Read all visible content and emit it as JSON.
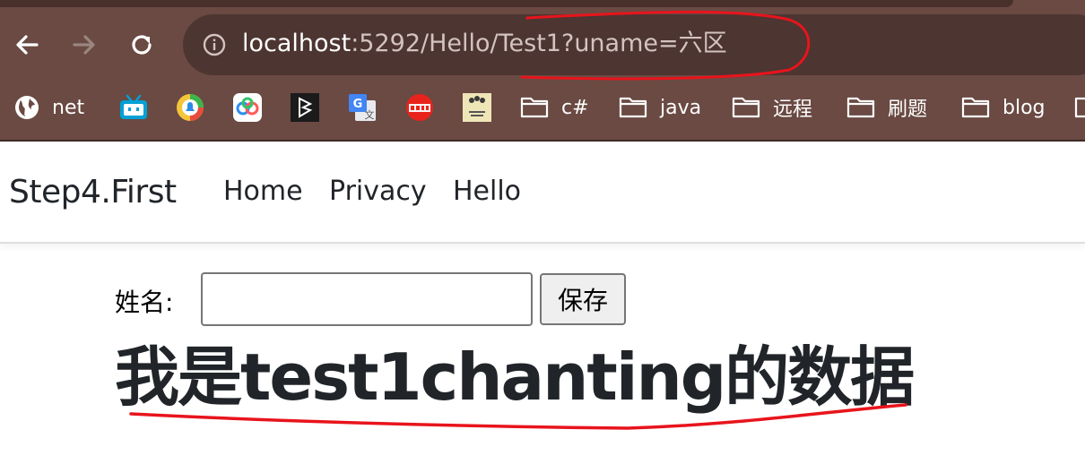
{
  "browser": {
    "url": {
      "host": "localhost",
      "path": ":5292/Hello/Test1?uname=六区"
    },
    "nav": {
      "back_icon": "arrow-left-icon",
      "forward_icon": "arrow-right-icon",
      "reload_icon": "reload-icon",
      "info_icon": "info-icon"
    },
    "bookmarks": [
      {
        "label": "net",
        "icon": "globe-icon"
      },
      {
        "label": "",
        "icon": "bilibili-icon"
      },
      {
        "label": "",
        "icon": "bell-icon"
      },
      {
        "label": "",
        "icon": "baidu-pan-icon"
      },
      {
        "label": "",
        "icon": "bilibili-dark-icon"
      },
      {
        "label": "",
        "icon": "google-translate-icon"
      },
      {
        "label": "",
        "icon": "toutiao-icon"
      },
      {
        "label": "",
        "icon": "java-icon"
      },
      {
        "label": "c#",
        "icon": "folder-icon"
      },
      {
        "label": "java",
        "icon": "folder-icon"
      },
      {
        "label": "远程",
        "icon": "folder-icon"
      },
      {
        "label": "刷题",
        "icon": "folder-icon"
      },
      {
        "label": "blog",
        "icon": "folder-icon"
      }
    ],
    "colors": {
      "chrome": "#6a4a43",
      "omnibox": "#4d3531"
    }
  },
  "site": {
    "brand": "Step4.First",
    "nav": [
      "Home",
      "Privacy",
      "Hello"
    ]
  },
  "form": {
    "name_label": "姓名:",
    "name_value": "",
    "save_label": "保存"
  },
  "content": {
    "heading": "我是test1chanting的数据"
  },
  "annotation_color": "#e8141c"
}
